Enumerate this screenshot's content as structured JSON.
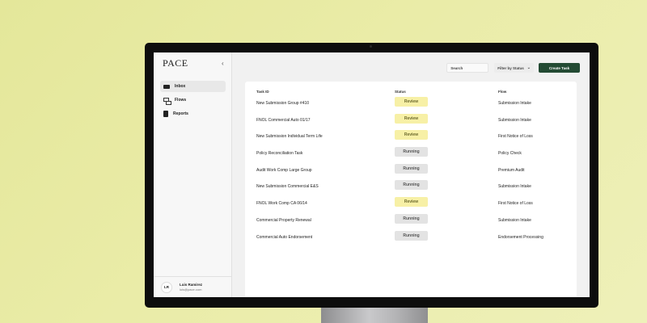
{
  "app": {
    "logo": "PACE",
    "collapse_icon": "‹"
  },
  "sidebar": {
    "items": [
      {
        "label": "Inbox",
        "icon": "inbox-icon",
        "active": true
      },
      {
        "label": "Flows",
        "icon": "flows-icon",
        "active": false
      },
      {
        "label": "Reports",
        "icon": "reports-icon",
        "active": false
      }
    ],
    "user": {
      "initials": "LR",
      "name": "Luis Ramirez",
      "email": "luis@pace.com"
    }
  },
  "toolbar": {
    "search_placeholder": "Search",
    "filter_label": "Filter by Status",
    "filter_chevron": "⌄",
    "create_label": "Create Task",
    "create_color": "#234a33"
  },
  "table": {
    "headers": {
      "task": "Task ID",
      "status": "Status",
      "flow": "Flow"
    },
    "rows": [
      {
        "task": "New Submission Group #410",
        "status": "Review",
        "flow": "Submission Intake"
      },
      {
        "task": "FNOL Commercial Auto 01/17",
        "status": "Review",
        "flow": "Submission Intake"
      },
      {
        "task": "New Submission Individual Term Life",
        "status": "Review",
        "flow": "First Notice of Loss"
      },
      {
        "task": "Policy Reconciliation Task",
        "status": "Running",
        "flow": "Policy Check"
      },
      {
        "task": "Audit Work Comp Large Group",
        "status": "Running",
        "flow": "Premium Audit"
      },
      {
        "task": "New Submission Commercial E&S",
        "status": "Running",
        "flow": "Submission Intake"
      },
      {
        "task": "FNOL Work Comp CA 06/14",
        "status": "Review",
        "flow": "First Notice of Loss"
      },
      {
        "task": "Commercial Property Renewal",
        "status": "Running",
        "flow": "Submission Intake"
      },
      {
        "task": "Commercial Auto Endorsement",
        "status": "Running",
        "flow": "Endorsement Processing"
      }
    ]
  },
  "colors": {
    "review_bg": "#f7f0a6",
    "running_bg": "#e3e3e3",
    "background": "#e4e79a"
  }
}
